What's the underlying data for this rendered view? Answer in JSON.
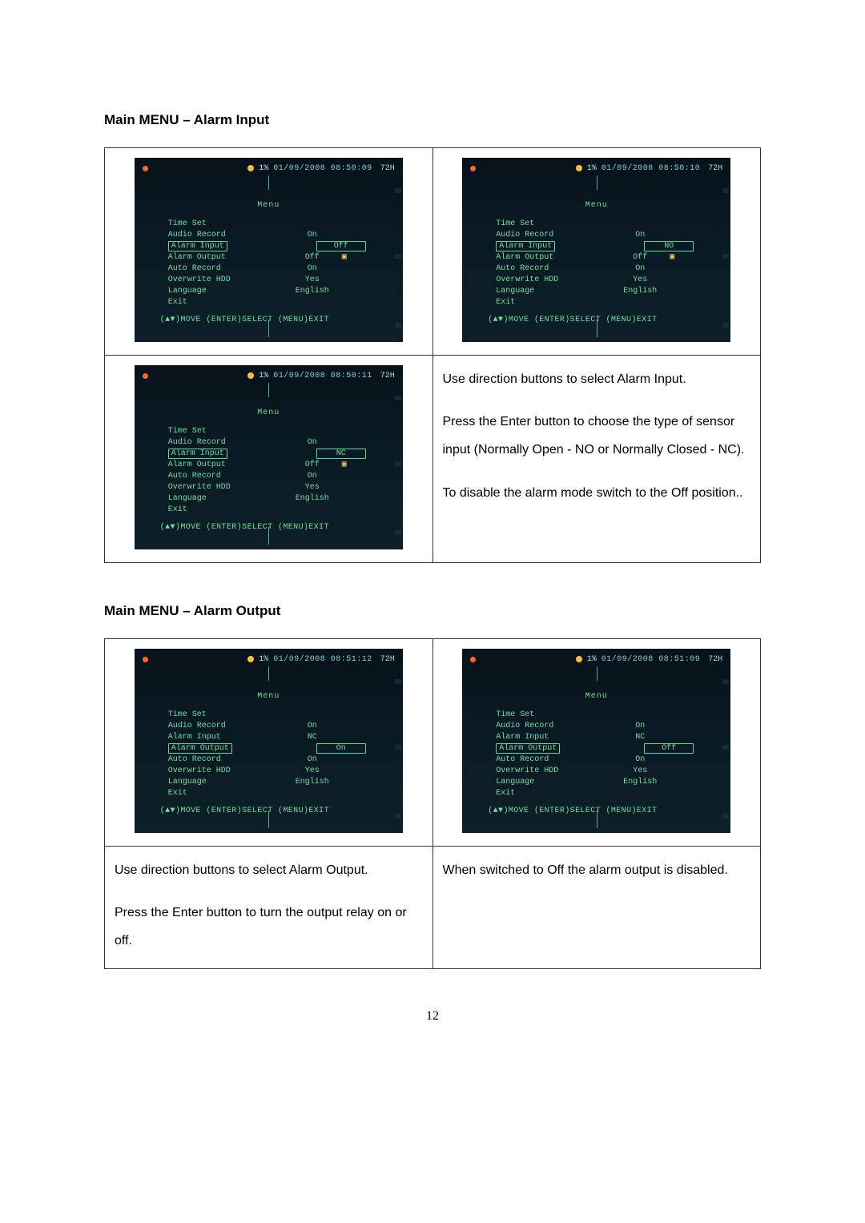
{
  "section1": {
    "title": "Main MENU – Alarm Input",
    "instructions": [
      "Use direction buttons to select Alarm Input.",
      "Press the Enter button to choose the type of sensor input (Normally Open - NO or Normally Closed - NC).",
      "To disable the alarm mode switch to the Off position.."
    ]
  },
  "section2": {
    "title": "Main MENU – Alarm Output",
    "left_caption_lines": [
      "Use direction buttons to select Alarm Output.",
      "Press the Enter button to turn the output relay on or off."
    ],
    "right_caption_lines": [
      "When switched to Off the alarm output is disabled."
    ]
  },
  "menu": {
    "header": "Menu",
    "hint": "(▲▼)MOVE (ENTER)SELECT (MENU)EXIT",
    "items": {
      "time_set": "Time Set",
      "audio_record": "Audio Record",
      "alarm_input": "Alarm Input",
      "alarm_output": "Alarm Output",
      "auto_record": "Auto Record",
      "overwrite_hdd": "Overwrite HDD",
      "language": "Language",
      "exit": "Exit"
    },
    "values": {
      "on": "On",
      "off": "Off",
      "yes": "Yes",
      "english": "English",
      "no_": "NO",
      "nc": "NC"
    }
  },
  "screens": {
    "pct": "1%",
    "hr": "72H",
    "ts1": "01/09/2008 08:50:09",
    "ts2": "01/09/2008 08:50:10",
    "ts3": "01/09/2008 08:50:11",
    "ts4": "01/09/2008 08:51:12",
    "ts5": "01/09/2008 08:51:09",
    "input_off": {
      "alarm_input": "Off",
      "highlight": "alarm_input"
    },
    "input_no": {
      "alarm_input": "NO",
      "highlight": "alarm_input"
    },
    "input_nc": {
      "alarm_input": "NC",
      "highlight": "alarm_input"
    },
    "output_on": {
      "alarm_output": "On",
      "highlight": "alarm_output"
    },
    "output_off": {
      "alarm_output": "Off",
      "highlight": "alarm_output"
    }
  },
  "page_number": "12"
}
